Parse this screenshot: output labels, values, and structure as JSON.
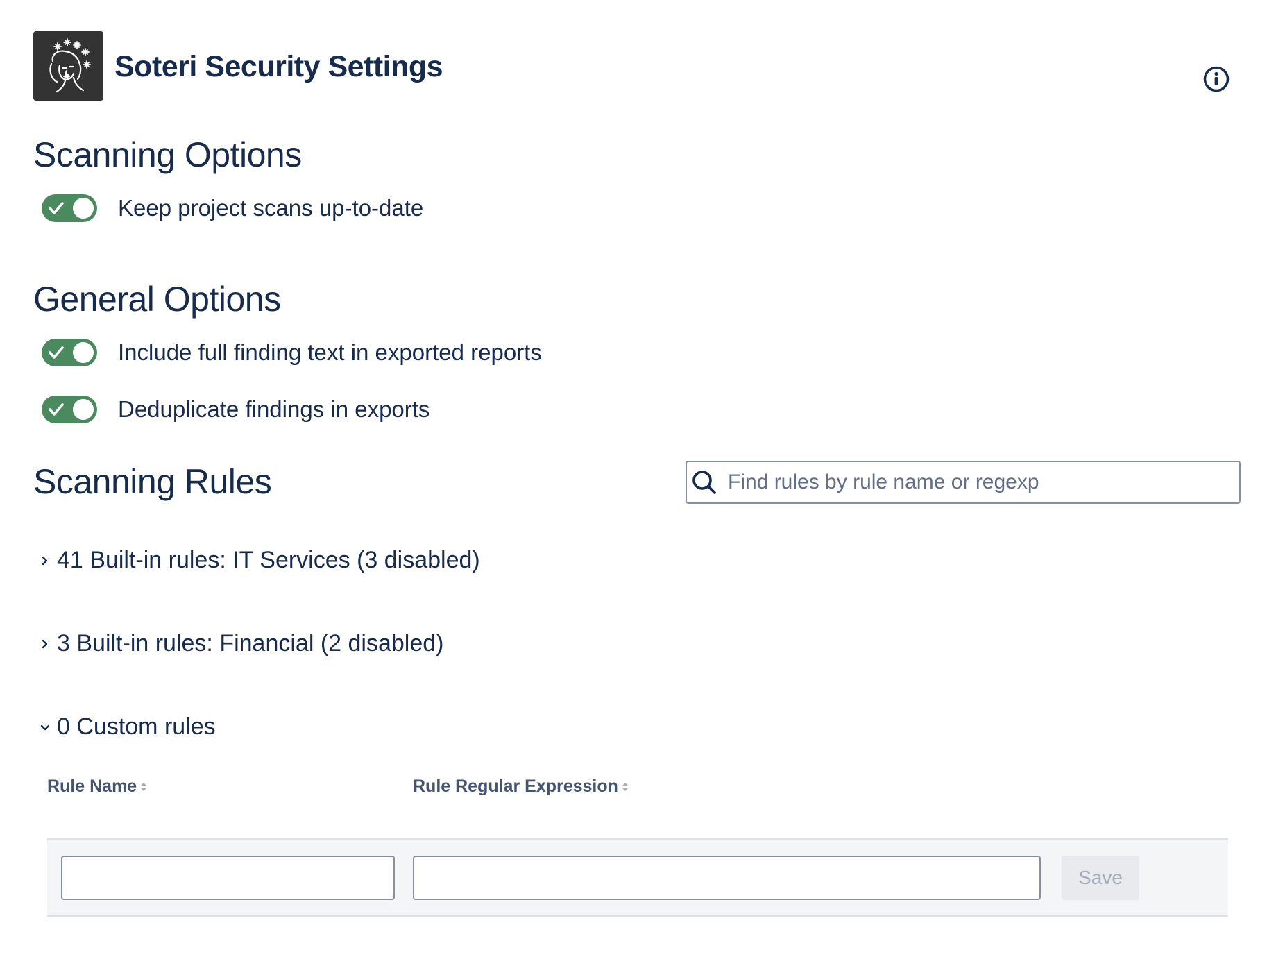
{
  "header": {
    "title": "Soteri Security Settings",
    "logo_icon": "woman-face-logo",
    "info_icon": "info-icon"
  },
  "scanning_options": {
    "title": "Scanning Options",
    "toggles": [
      {
        "label": "Keep project scans up-to-date",
        "checked": true
      }
    ]
  },
  "general_options": {
    "title": "General Options",
    "toggles": [
      {
        "label": "Include full finding text in exported reports",
        "checked": true
      },
      {
        "label": "Deduplicate findings in exports",
        "checked": true
      }
    ]
  },
  "scanning_rules": {
    "title": "Scanning Rules",
    "search": {
      "placeholder": "Find rules by rule name or regexp",
      "value": ""
    },
    "groups": [
      {
        "label": "41 Built-in rules: IT Services (3 disabled)",
        "expanded": false
      },
      {
        "label": "3 Built-in rules: Financial (2 disabled)",
        "expanded": false
      },
      {
        "label": "0 Custom rules",
        "expanded": true
      }
    ],
    "table": {
      "columns": [
        "Rule Name",
        "Rule Regular Expression"
      ],
      "new_row": {
        "rule_name": "",
        "rule_regexp": "",
        "save_label": "Save"
      }
    }
  },
  "colors": {
    "toggle_on": "#4b8a5e",
    "heading": "#172b4d",
    "logo_bg": "#333333"
  }
}
